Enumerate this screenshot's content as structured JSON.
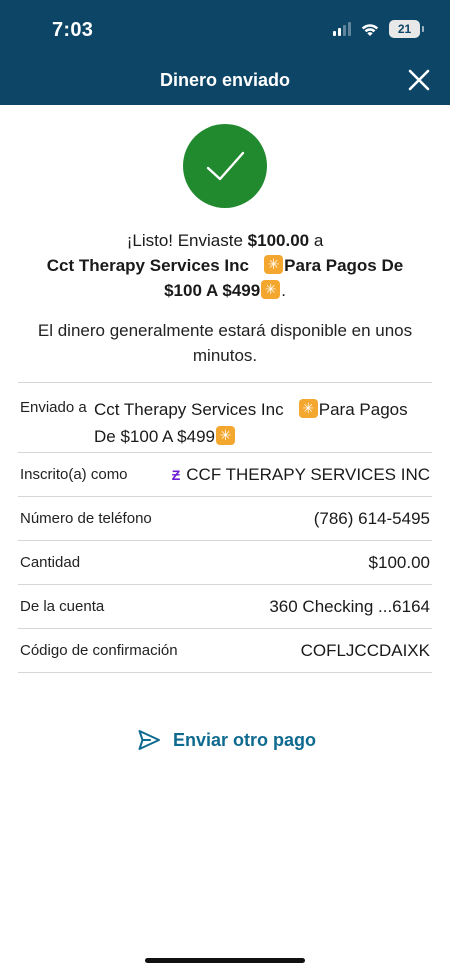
{
  "status_bar": {
    "time": "7:03",
    "battery": "21"
  },
  "header": {
    "title": "Dinero enviado"
  },
  "confirmation": {
    "prefix": "¡Listo! Enviaste ",
    "amount": "$100.00",
    "connector": " a",
    "recipient_line1": "Cct Therapy Services Inc",
    "recipient_line1b": "Para Pagos De",
    "recipient_line2": "$100 A $499",
    "period": ".",
    "availability": "El dinero generalmente estará disponible en unos minutos."
  },
  "details": {
    "sent_to": {
      "label": "Enviado a",
      "value_part1": "Cct Therapy Services Inc",
      "value_part2": "Para Pagos",
      "value_part3": "De $100 A $499"
    },
    "enrolled_as": {
      "label": "Inscrito(a) como",
      "value": "CCF THERAPY SERVICES INC"
    },
    "phone": {
      "label": "Número de teléfono",
      "value": "(786) 614-5495"
    },
    "amount": {
      "label": "Cantidad",
      "value": "$100.00"
    },
    "account": {
      "label": "De la cuenta",
      "value": "360 Checking ...6164"
    },
    "confirmation_code": {
      "label": "Código de confirmación",
      "value": "COFLJCCDAIXK"
    }
  },
  "actions": {
    "send_another": "Enviar otro pago"
  },
  "icons": {
    "check": "checkmark-icon",
    "close": "close-icon",
    "send": "paper-plane-icon",
    "zelle": "zelle-logo-icon",
    "emoji": "eight-pointed-star-emoji-icon"
  },
  "colors": {
    "header_bg": "#0d4566",
    "success_green": "#228a2e",
    "link_blue": "#0f6a8f",
    "zelle_purple": "#6b1cd1",
    "emoji_orange": "#f4a72e"
  }
}
